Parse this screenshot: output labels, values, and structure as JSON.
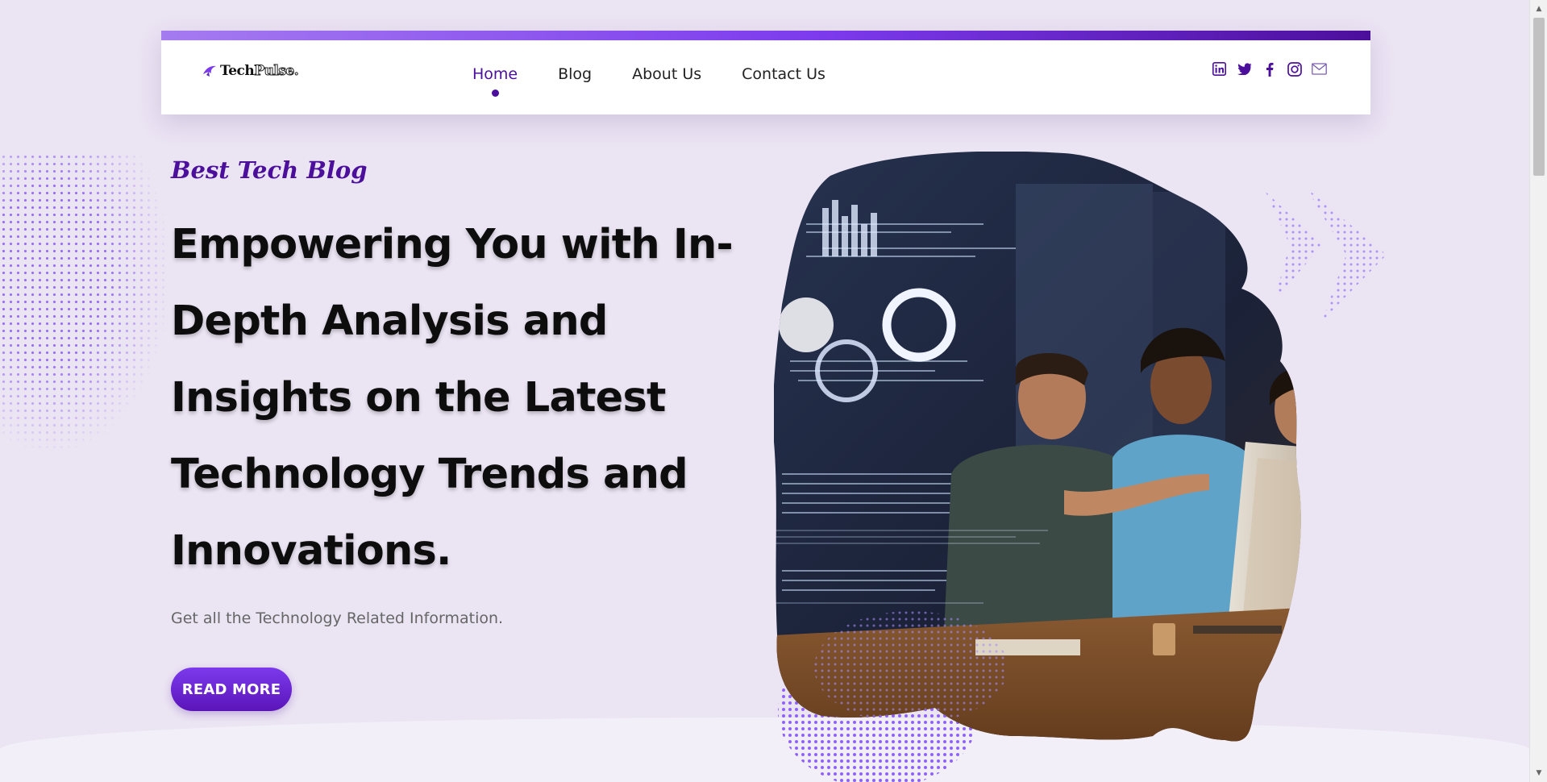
{
  "brand": {
    "logo_part1": "Tech",
    "logo_part2": "Pulse.",
    "accent": "#4b0f9c",
    "accent_light": "#7c3aed"
  },
  "nav": {
    "items": [
      {
        "label": "Home",
        "active": true
      },
      {
        "label": "Blog",
        "active": false
      },
      {
        "label": "About Us",
        "active": false
      },
      {
        "label": "Contact Us",
        "active": false
      }
    ]
  },
  "social_icons": [
    "linkedin-icon",
    "twitter-icon",
    "facebook-icon",
    "instagram-icon",
    "mail-icon"
  ],
  "hero": {
    "tag": "Best Tech Blog",
    "title": "Empowering You with In-Depth Analysis and Insights on the Latest Technology Trends and Innovations.",
    "subtitle": "Get all the Technology Related Information.",
    "cta_label": "READ MORE"
  },
  "scrollbar": {
    "up_glyph": "▲",
    "down_glyph": "▼"
  }
}
